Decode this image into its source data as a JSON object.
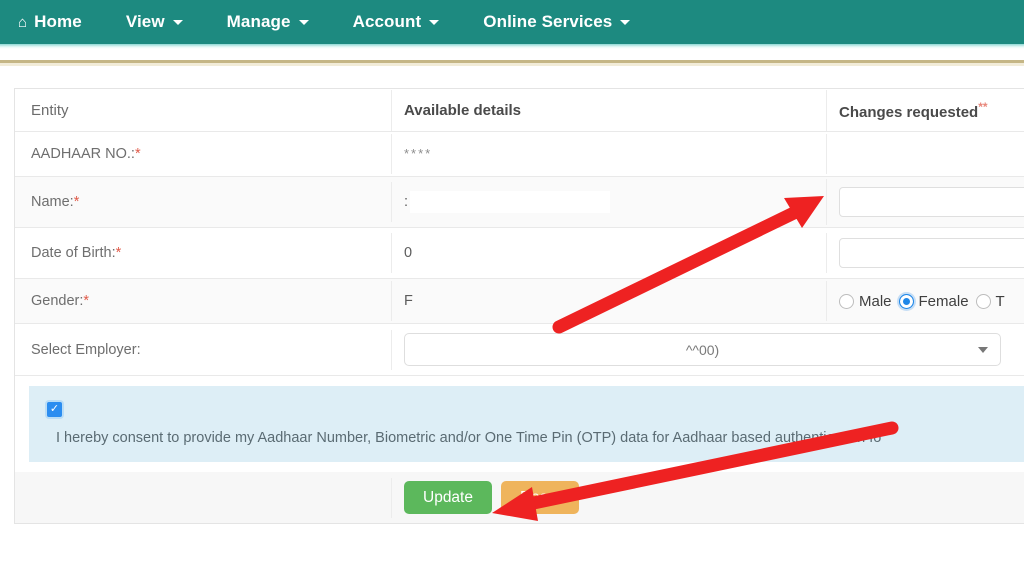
{
  "navbar": {
    "brand_color": "#1d8a80",
    "items": [
      {
        "label": "Home",
        "icon": "home-icon",
        "has_caret": false
      },
      {
        "label": "View",
        "icon": "",
        "has_caret": true
      },
      {
        "label": "Manage",
        "icon": "",
        "has_caret": true
      },
      {
        "label": "Account",
        "icon": "",
        "has_caret": true
      },
      {
        "label": "Online Services",
        "icon": "",
        "has_caret": true
      }
    ]
  },
  "divider": {
    "color": "#c2b280"
  },
  "table": {
    "headers": {
      "entity": "Entity",
      "available": "Available details",
      "changes": "Changes requested",
      "changes_marker": "**"
    },
    "rows": [
      {
        "entity_label": "AADHAAR NO.:",
        "required_marker": "*",
        "available_value": "****",
        "available_kind": "masked-dots",
        "changes_kind": "empty"
      },
      {
        "entity_label": "Name:",
        "required_marker": "*",
        "available_value": ":",
        "available_kind": "redacted-bar",
        "changes_kind": "text-input",
        "changes_value": "",
        "changes_placeholder": ""
      },
      {
        "entity_label": "Date of Birth:",
        "required_marker": "*",
        "available_value": "0",
        "available_kind": "partial-text",
        "changes_kind": "text-input",
        "changes_value": "",
        "changes_placeholder": ""
      },
      {
        "entity_label": "Gender:",
        "required_marker": "*",
        "available_value": "F",
        "available_kind": "partial-text",
        "changes_kind": "radio-group",
        "radios": [
          {
            "label": "Male",
            "selected": false
          },
          {
            "label": "Female",
            "selected": true
          },
          {
            "label": "T",
            "selected": false
          }
        ]
      },
      {
        "entity_label": "Select Employer:",
        "required_marker": "",
        "available_kind": "select",
        "changes_kind": "none",
        "select_value": "^^00)"
      }
    ]
  },
  "consent": {
    "checked": true,
    "checkmark": "✓",
    "text": "I hereby consent to provide my Aadhaar Number, Biometric and/or One Time Pin (OTP) data for Aadhaar based authentication fo"
  },
  "actions": {
    "update_label": "Update",
    "reset_label": "Reset",
    "update_color": "#5cb85c",
    "reset_color": "#efb45c"
  },
  "annotations": {
    "arrow_color": "#ee2222",
    "arrow_1": "points to the Name changes-requested input",
    "arrow_2": "points to the Update button"
  }
}
